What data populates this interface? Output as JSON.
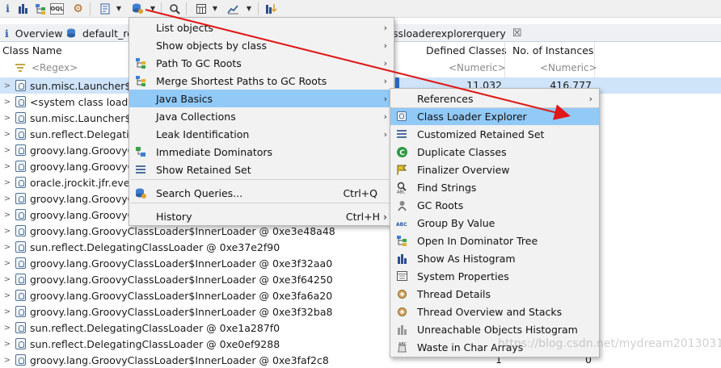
{
  "colors": {
    "accent": "#91c9f7",
    "selected_row": "#cfe3f9",
    "arrow": "#e01818",
    "bar": "#2d6fd1"
  },
  "toolbar": {
    "icons": [
      "info-icon",
      "histogram-icon",
      "dominator-tree-icon",
      "oql-icon",
      "gear-icon",
      "report-icon",
      "query-browser-icon",
      "search-icon",
      "calculator-icon",
      "compare-icon",
      "export-icon"
    ],
    "oql_label": "OQL"
  },
  "tabs": {
    "overview": "Overview",
    "default_report": "default_re",
    "query": "ssloaderexplorerquery",
    "close": "☒"
  },
  "columns": {
    "class_name": "Class Name",
    "defined_classes": "Defined Classes",
    "instances": "No. of Instances"
  },
  "filters": {
    "regex": "<Regex>",
    "numeric": "<Numeric>"
  },
  "rows": [
    {
      "name": "sun.misc.Launcher$Ap",
      "defined": "11,032",
      "instances": "416,777"
    },
    {
      "name": "<system class loader",
      "defined": "",
      "instances": ""
    },
    {
      "name": "sun.misc.Launcher$Ex",
      "defined": "",
      "instances": ""
    },
    {
      "name": "sun.reflect.Delegating",
      "defined": "",
      "instances": ""
    },
    {
      "name": "groovy.lang.GroovyC",
      "defined": "",
      "instances": ""
    },
    {
      "name": "groovy.lang.GroovyC",
      "defined": "",
      "instances": ""
    },
    {
      "name": "oracle.jrockit.jfr.event",
      "defined": "",
      "instances": ""
    },
    {
      "name": "groovy.lang.GroovyC",
      "defined": "",
      "instances": ""
    },
    {
      "name": "groovy.lang.GroovyC",
      "defined": "",
      "instances": ""
    },
    {
      "name": "groovy.lang.GroovyClassLoader$InnerLoader @ 0xe3e48a48",
      "defined": "",
      "instances": ""
    },
    {
      "name": "sun.reflect.DelegatingClassLoader @ 0xe37e2f90",
      "defined": "",
      "instances": ""
    },
    {
      "name": "groovy.lang.GroovyClassLoader$InnerLoader @ 0xe3f32aa0",
      "defined": "",
      "instances": ""
    },
    {
      "name": "groovy.lang.GroovyClassLoader$InnerLoader @ 0xe3f64250",
      "defined": "",
      "instances": ""
    },
    {
      "name": "groovy.lang.GroovyClassLoader$InnerLoader @ 0xe3fa6a20",
      "defined": "",
      "instances": ""
    },
    {
      "name": "groovy.lang.GroovyClassLoader$InnerLoader @ 0xe3f32ba8",
      "defined": "",
      "instances": ""
    },
    {
      "name": "sun.reflect.DelegatingClassLoader @ 0xe1a287f0",
      "defined": "",
      "instances": ""
    },
    {
      "name": "sun.reflect.DelegatingClassLoader @ 0xe0ef9288",
      "defined": "",
      "instances": ""
    },
    {
      "name": "groovy.lang.GroovyClassLoader$InnerLoader @ 0xe3faf2c8",
      "defined": "1",
      "instances": "0"
    }
  ],
  "menu": {
    "items": [
      {
        "label": "List objects",
        "icon": "",
        "arrow": "›",
        "shortcut": ""
      },
      {
        "label": "Show objects by class",
        "icon": "",
        "arrow": "›",
        "shortcut": ""
      },
      {
        "label": "Path To GC Roots",
        "icon": "path-gc-roots-icon",
        "arrow": "›",
        "shortcut": ""
      },
      {
        "label": "Merge Shortest Paths to GC Roots",
        "icon": "merge-paths-icon",
        "arrow": "›",
        "shortcut": ""
      },
      {
        "label": "Java Basics",
        "icon": "",
        "arrow": "›",
        "shortcut": ""
      },
      {
        "label": "Java Collections",
        "icon": "",
        "arrow": "›",
        "shortcut": ""
      },
      {
        "label": "Leak Identification",
        "icon": "",
        "arrow": "›",
        "shortcut": ""
      },
      {
        "label": "Immediate Dominators",
        "icon": "immediate-dominators-icon",
        "arrow": "",
        "shortcut": ""
      },
      {
        "label": "Show Retained Set",
        "icon": "retained-set-icon",
        "arrow": "",
        "shortcut": ""
      },
      {
        "label": "Search Queries...",
        "icon": "search-queries-icon",
        "arrow": "",
        "shortcut": "Ctrl+Q"
      },
      {
        "label": "History",
        "icon": "",
        "arrow": "",
        "shortcut": "Ctrl+H ›"
      }
    ]
  },
  "submenu": {
    "items": [
      {
        "label": "References",
        "icon": "",
        "arrow": "›"
      },
      {
        "label": "Class Loader Explorer",
        "icon": "class-loader-icon",
        "arrow": ""
      },
      {
        "label": "Customized Retained Set",
        "icon": "retained-set-icon",
        "arrow": ""
      },
      {
        "label": "Duplicate Classes",
        "icon": "duplicate-classes-icon",
        "arrow": ""
      },
      {
        "label": "Finalizer Overview",
        "icon": "finalizer-icon",
        "arrow": ""
      },
      {
        "label": "Find Strings",
        "icon": "find-strings-icon",
        "arrow": ""
      },
      {
        "label": "GC Roots",
        "icon": "gc-roots-icon",
        "arrow": ""
      },
      {
        "label": "Group By Value",
        "icon": "group-by-value-icon",
        "arrow": ""
      },
      {
        "label": "Open In Dominator Tree",
        "icon": "dominator-tree-icon",
        "arrow": ""
      },
      {
        "label": "Show As Histogram",
        "icon": "histogram-icon",
        "arrow": ""
      },
      {
        "label": "System Properties",
        "icon": "system-properties-icon",
        "arrow": ""
      },
      {
        "label": "Thread Details",
        "icon": "thread-details-icon",
        "arrow": ""
      },
      {
        "label": "Thread Overview and Stacks",
        "icon": "thread-overview-icon",
        "arrow": ""
      },
      {
        "label": "Unreachable Objects Histogram",
        "icon": "unreachable-histogram-icon",
        "arrow": ""
      },
      {
        "label": "Waste in Char Arrays",
        "icon": "waste-char-arrays-icon",
        "arrow": ""
      }
    ]
  },
  "watermark": "https://blog.csdn.net/mydream20130314"
}
